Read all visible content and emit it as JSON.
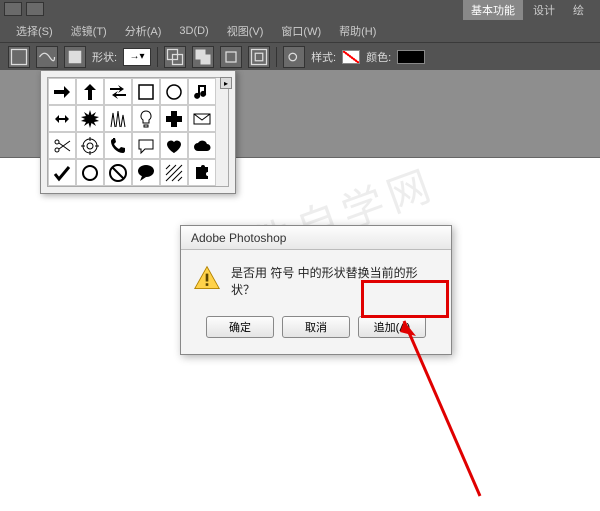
{
  "tabs": {
    "basic": "基本功能",
    "design": "设计",
    "paint": "绘"
  },
  "menu": {
    "select": "选择(S)",
    "filter": "滤镜(T)",
    "analyze": "分析(A)",
    "threed": "3D(D)",
    "view": "视图(V)",
    "window": "窗口(W)",
    "help": "帮助(H)"
  },
  "optbar": {
    "shape_label": "形状:",
    "style_label": "样式:",
    "color_label": "颜色:"
  },
  "shape_popup": {
    "icons": [
      "arrow-right",
      "arrow-up",
      "arrow-swap",
      "square",
      "circle",
      "note",
      "arrow-expand",
      "burst",
      "grass",
      "bulb",
      "cross",
      "mail",
      "scissors",
      "target",
      "phone",
      "chat",
      "heart",
      "cloud",
      "check",
      "circle-outline",
      "no-entry",
      "speech",
      "hatch",
      "puzzle"
    ]
  },
  "dialog": {
    "title": "Adobe Photoshop",
    "message": "是否用 符号 中的形状替换当前的形状？",
    "ok": "确定",
    "cancel": "取消",
    "append": "追加(A)"
  },
  "watermark": "软件自学网"
}
